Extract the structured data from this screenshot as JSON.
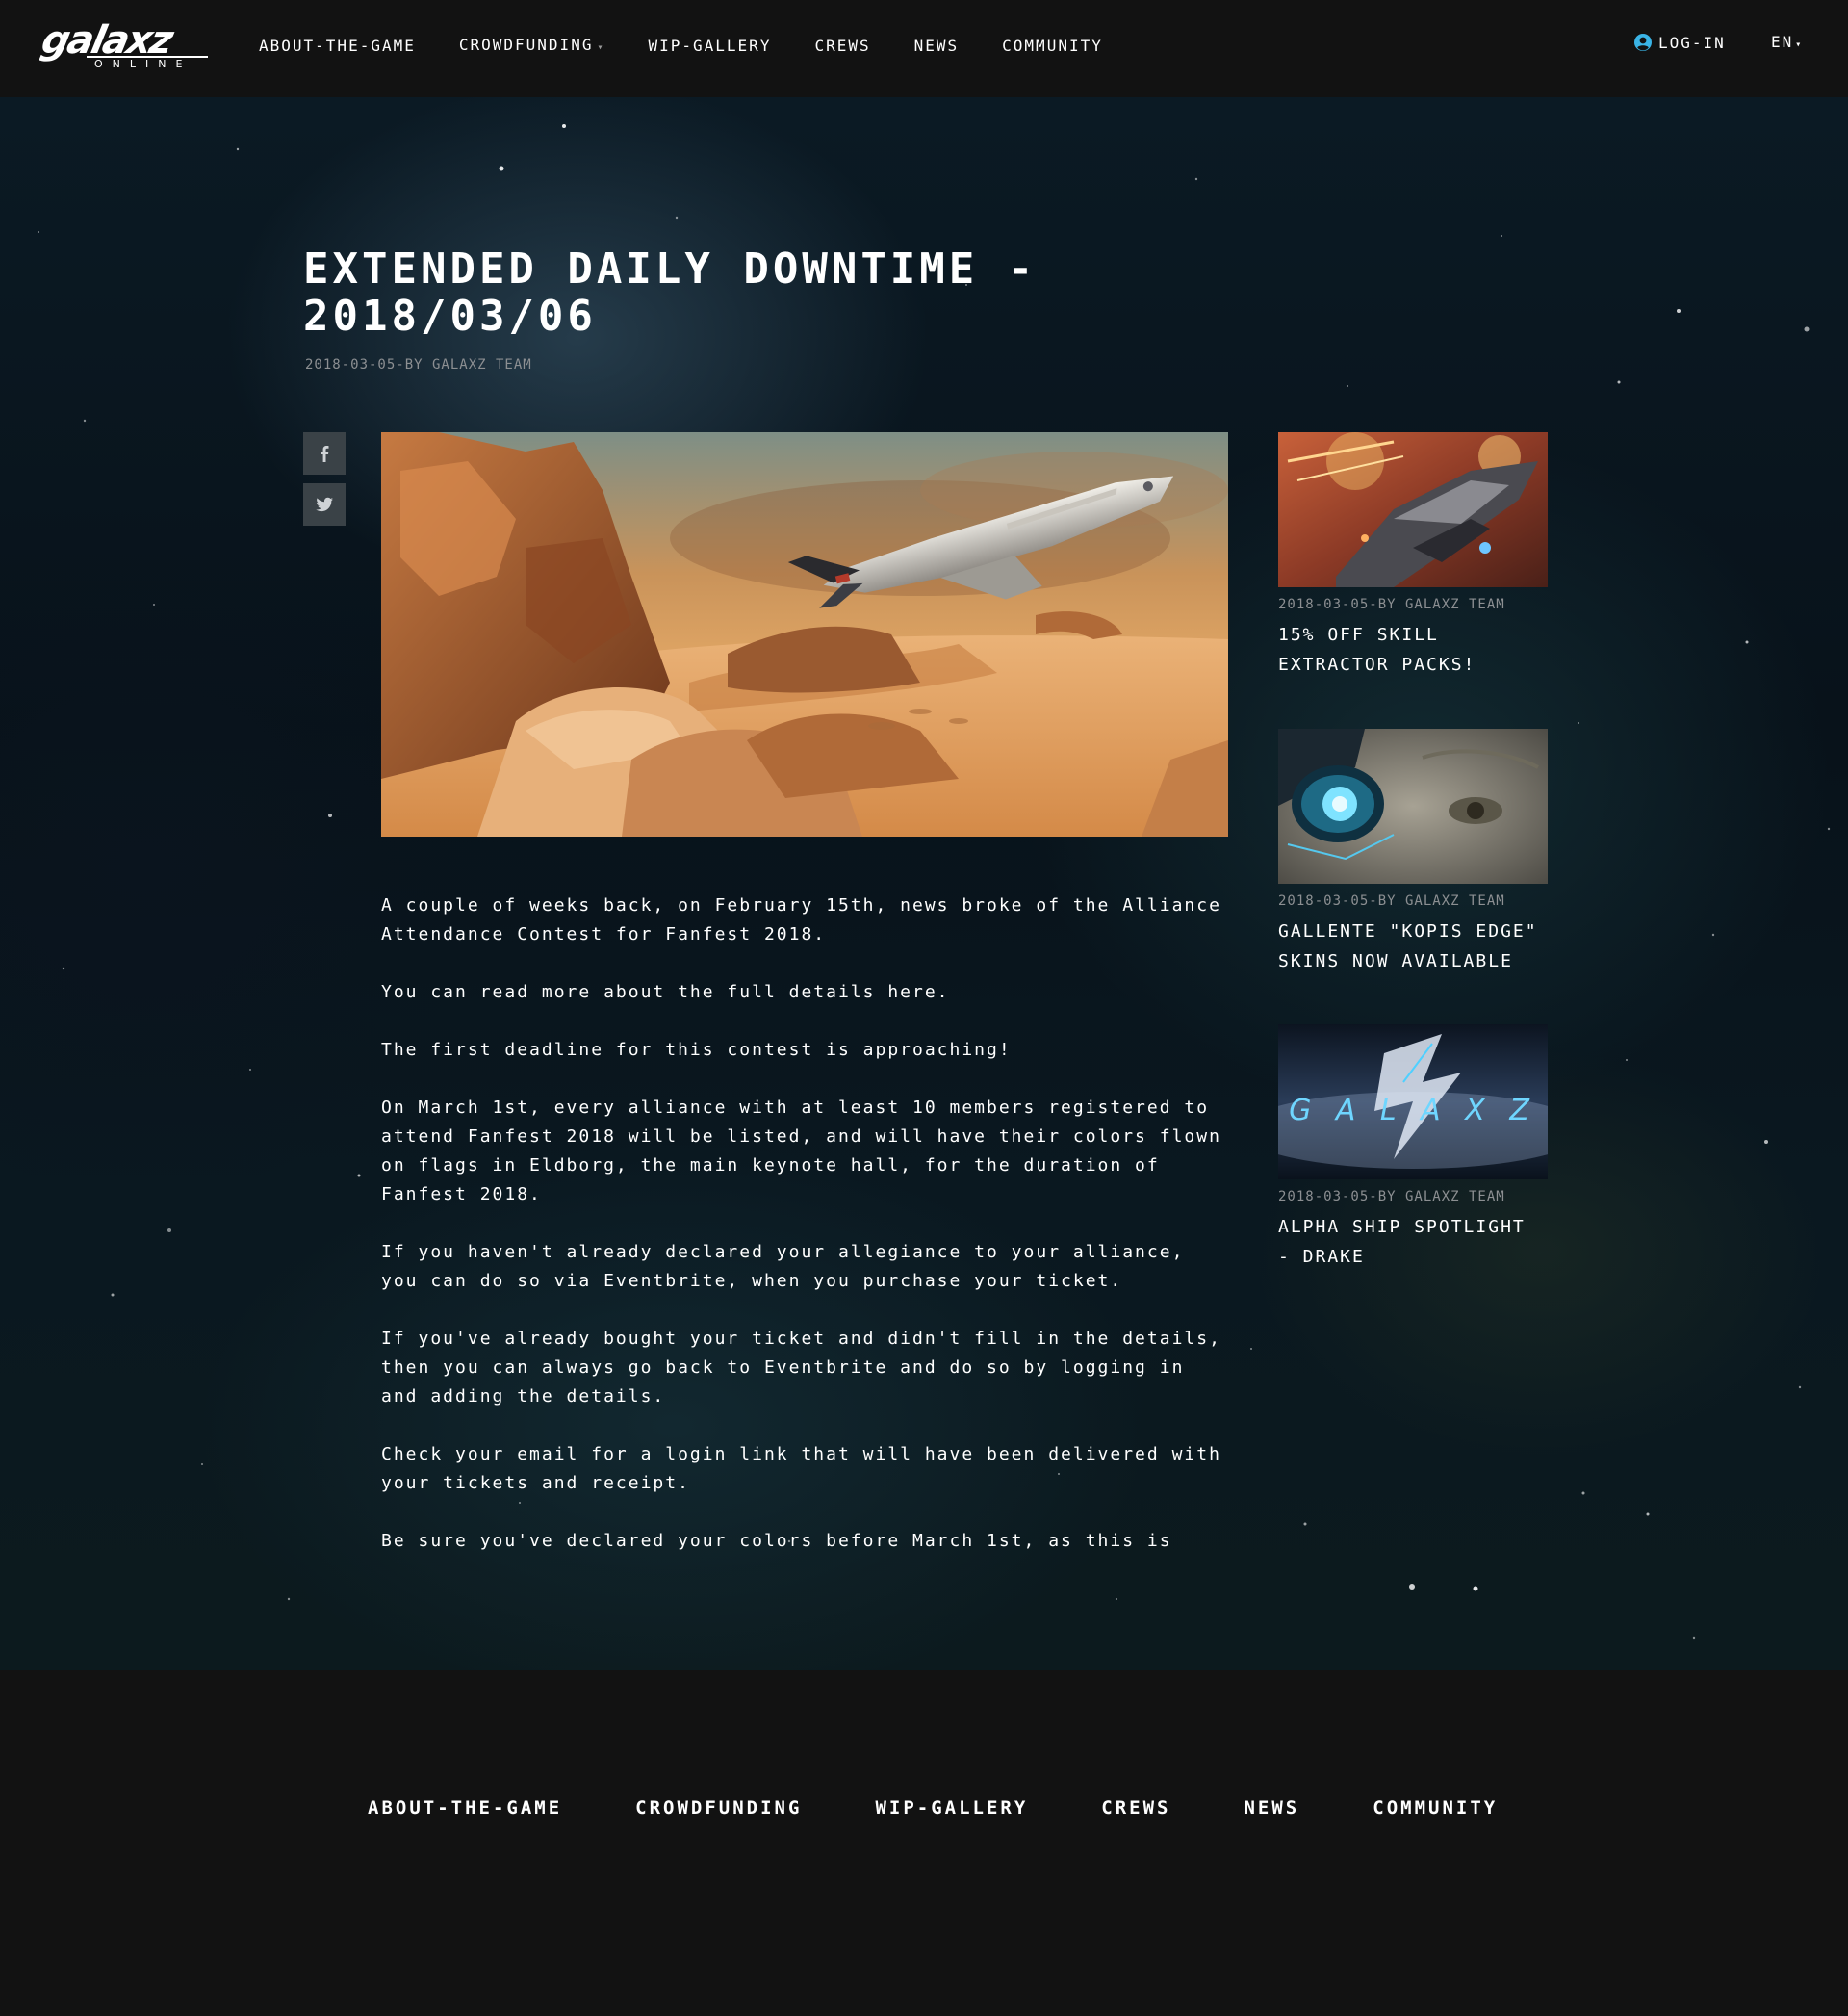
{
  "header": {
    "logo_text": "galaxz",
    "logo_sub": "ONLINE",
    "nav": [
      {
        "label": "ABOUT-THE-GAME"
      },
      {
        "label": "CROWDFUNDING"
      },
      {
        "label": "WIP-GALLERY"
      },
      {
        "label": "CREWS"
      },
      {
        "label": "NEWS"
      },
      {
        "label": "COMMUNITY"
      }
    ],
    "login_label": "LOG-IN",
    "lang_label": "EN"
  },
  "article": {
    "title": "EXTENDED DAILY DOWNTIME - 2018/03/06",
    "meta": "2018-03-05-BY GALAXZ TEAM",
    "paragraphs": [
      "A couple of weeks back, on February 15th, news broke of the Alliance Attendance Contest for Fanfest 2018.",
      "You can read more about the full details here.",
      "The first deadline for this contest is approaching!",
      "On March 1st, every alliance with at least 10 members registered to attend Fanfest 2018 will be listed, and will have their colors flown on flags in Eldborg, the main keynote hall, for the duration of Fanfest 2018.",
      "If you haven't already declared your allegiance to your alliance, you can do so via Eventbrite, when you purchase your ticket.",
      "If you've already bought your ticket and didn't fill in the details, then you can always go back to Eventbrite and do so by logging in and adding the details.",
      "Check your email for a login link that will have been delivered with your tickets and receipt.",
      "Be sure you've declared your colors before March 1st, as this is"
    ]
  },
  "share": {
    "facebook": "facebook-icon",
    "twitter": "twitter-icon"
  },
  "sidebar": [
    {
      "meta": "2018-03-05-BY GALAXZ TEAM",
      "title": "15% OFF SKILL EXTRACTOR PACKS!"
    },
    {
      "meta": "2018-03-05-BY GALAXZ TEAM",
      "title": "GALLENTE \"KOPIS EDGE\" SKINS NOW AVAILABLE"
    },
    {
      "meta": "2018-03-05-BY GALAXZ TEAM",
      "title": "ALPHA SHIP SPOTLIGHT - DRAKE",
      "thumb_text": "G A L A X Z"
    }
  ],
  "footer": {
    "nav": [
      {
        "label": "ABOUT-THE-GAME"
      },
      {
        "label": "CROWDFUNDING"
      },
      {
        "label": "WIP-GALLERY"
      },
      {
        "label": "CREWS"
      },
      {
        "label": "NEWS"
      },
      {
        "label": "COMMUNITY"
      }
    ]
  },
  "colors": {
    "header_bg": "#121212",
    "meta_gray": "#8c8f92",
    "share_bg": "#3a4247",
    "accent_blue": "#3ab4e6"
  }
}
